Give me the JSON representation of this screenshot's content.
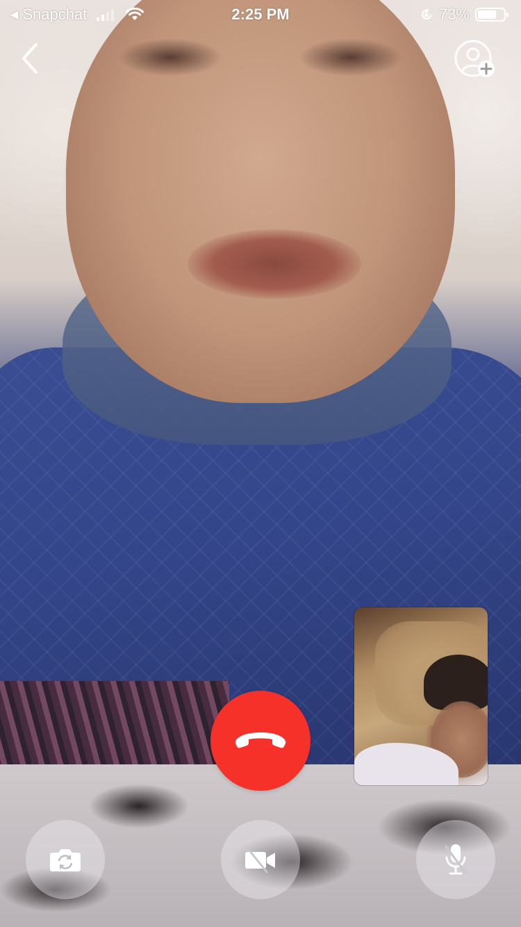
{
  "status_bar": {
    "back_app_label": "Snapchat",
    "time": "2:25 PM",
    "battery_percent_label": "73%",
    "battery_level": 0.73,
    "signal_bars_active": 2,
    "signal_bars_total": 4
  },
  "call": {
    "back_icon": "chevron-left-icon",
    "add_participant_icon": "add-friend-icon",
    "end_call_icon": "hang-up-phone-icon",
    "end_call_color": "#f5312a",
    "controls": [
      {
        "name": "flip-camera",
        "icon": "camera-flip-icon"
      },
      {
        "name": "video-toggle",
        "icon": "video-off-icon"
      },
      {
        "name": "mic-toggle",
        "icon": "microphone-off-icon"
      }
    ]
  }
}
